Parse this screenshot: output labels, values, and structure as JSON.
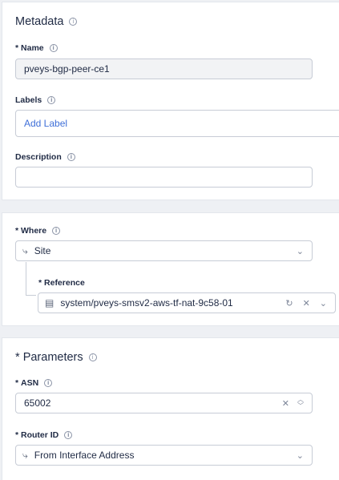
{
  "metadata": {
    "title": "Metadata",
    "name_label": "Name",
    "name_value": "pveys-bgp-peer-ce1",
    "labels_label": "Labels",
    "labels_add": "Add Label",
    "description_label": "Description",
    "description_value": ""
  },
  "where": {
    "label": "Where",
    "value": "Site",
    "reference_label": "Reference",
    "reference_value": "system/pveys-smsv2-aws-tf-nat-9c58-01"
  },
  "parameters": {
    "title": "Parameters",
    "asn_label": "ASN",
    "asn_value": "65002",
    "router_id_label": "Router ID",
    "router_id_value": "From Interface Address"
  },
  "required_mark": "*",
  "icons": {
    "info": "info-icon",
    "chevron": "chevron-down-icon",
    "refresh": "refresh-icon",
    "clear": "close-icon",
    "branch": "branch-icon",
    "document": "document-icon"
  },
  "colors": {
    "accent": "#3f6fd8",
    "text": "#1f2a44",
    "border": "#c7ccd6"
  }
}
